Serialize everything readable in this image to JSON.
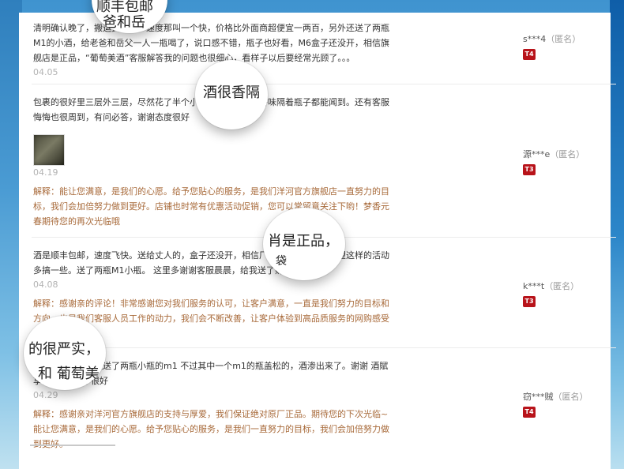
{
  "reviews": [
    {
      "text": "清明确认晚了，搬运费收得，速度那叫一个快，价格比外面商超便宜一两百，另外还送了两瓶M1的小酒，给老爸和岳父一人一瓶喝了，说口感不错，瓶子也好看，M6盒子还没开，相信旗舰店是正品，“葡萄美酒”客服解答我的问题也很细心，看样子以后要经常光顾了。。。",
      "date": "04.05",
      "user": "s***4",
      "anon": "（匿名）",
      "tier": "T4"
    },
    {
      "text": "包裹的很好里三层外三层，尽然花了半个小时才拆完，酒的香味隔着瓶子都能闻到。还有客服悔悔也很周到，有问必答，谢谢态度很好",
      "date": "04.19",
      "reply_label": "解释：",
      "reply": "能让您满意，是我们的心愿。给予您贴心的服务，是我们洋河官方旗舰店一直努力的目标，我们会加倍努力做到更好。店铺也时常有优惠活动促销，您可以常留意关注下哟！梦香元春期待您的再次光临哦",
      "user": "源***e",
      "anon": "（匿名）",
      "tier": "T3"
    },
    {
      "text": "酒是顺丰包邮，速度飞快。送给丈人的，盒子还没开，相信厂家直销是正品，希望这样的活动多搞一些。送了两瓶M1小瓶。 这里多谢谢客服晨晨，给我送了购物袋。",
      "date": "04.08",
      "reply_label": "解释：",
      "reply": "感谢亲的评论！非常感谢您对我们服务的认可，让客户满意，一直是我们努力的目标和方向，也是我们客服人员工作的动力，我们会不断改善，让客户体验到高品质服务的网购感受",
      "user": "k***t",
      "anon": "（匿名）",
      "tier": "T3"
    },
    {
      "text": "包装的很严实，还送了两瓶小瓶的m1 不过其中一个m1的瓶盖松的，酒渗出来了。谢谢 酒賦享。 总体不错 很好",
      "date": "04.29",
      "reply_label": "解释：",
      "reply": "感谢亲对洋河官方旗舰店的支持与厚爱，我们保证绝对原厂正品。期待您的下次光临~能让您满意，是我们的心愿。给予您贴心的服务，是我们一直努力的目标，我们会加倍努力做到更好。",
      "user": "窃***贼",
      "anon": "（匿名）",
      "tier": "T4"
    }
  ],
  "magnifiers": {
    "m1_line1": "顺丰包邮",
    "m1_line2": "爸和岳",
    "m2_text": "酒很香隔",
    "m3_line1": "肖是正品，",
    "m3_line2": "袋",
    "m4_line1": "的很严实，",
    "m4_line2": "和 葡萄美"
  }
}
